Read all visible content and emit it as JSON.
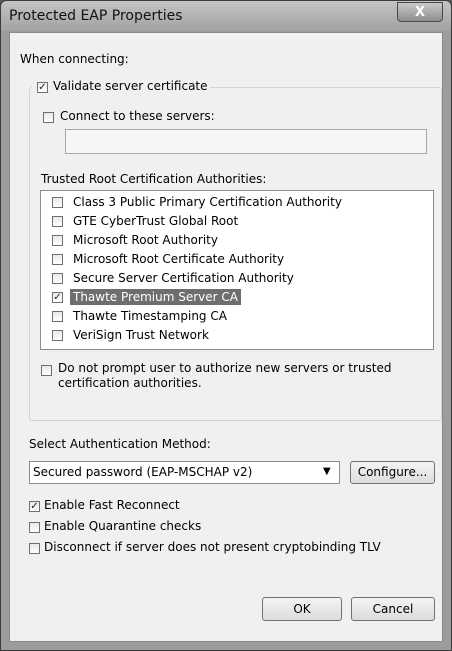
{
  "window": {
    "title": "Protected EAP Properties",
    "close_glyph": "X"
  },
  "when_connecting_label": "When connecting:",
  "validate_server_certificate": {
    "label": "Validate server certificate",
    "checked": true
  },
  "connect_to_servers": {
    "label": "Connect to these servers:",
    "checked": false,
    "value": ""
  },
  "trusted_root_label": "Trusted Root Certification Authorities:",
  "trusted_roots": [
    {
      "label": "Class 3 Public Primary Certification Authority",
      "checked": false,
      "selected": false
    },
    {
      "label": "GTE CyberTrust Global Root",
      "checked": false,
      "selected": false
    },
    {
      "label": "Microsoft Root Authority",
      "checked": false,
      "selected": false
    },
    {
      "label": "Microsoft Root Certificate Authority",
      "checked": false,
      "selected": false
    },
    {
      "label": "Secure Server Certification Authority",
      "checked": false,
      "selected": false
    },
    {
      "label": "Thawte Premium Server CA",
      "checked": true,
      "selected": true
    },
    {
      "label": "Thawte Timestamping CA",
      "checked": false,
      "selected": false
    },
    {
      "label": "VeriSign Trust Network",
      "checked": false,
      "selected": false
    }
  ],
  "do_not_prompt": {
    "label_line1": "Do not prompt user to authorize new servers or trusted",
    "label_line2": "certification authorities.",
    "checked": false
  },
  "auth_method": {
    "label": "Select Authentication Method:",
    "selected": "Secured password (EAP-MSCHAP v2)",
    "configure_label": "Configure..."
  },
  "options": [
    {
      "label": "Enable Fast Reconnect",
      "checked": true
    },
    {
      "label": "Enable Quarantine checks",
      "checked": false
    },
    {
      "label": "Disconnect if server does not present cryptobinding TLV",
      "checked": false
    }
  ],
  "buttons": {
    "ok": "OK",
    "cancel": "Cancel"
  },
  "icons": {
    "dropdown": "triangle-down",
    "check": "checkmark"
  }
}
